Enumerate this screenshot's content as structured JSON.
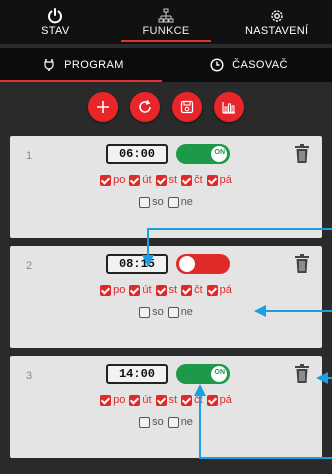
{
  "topnav": {
    "items": [
      {
        "label": "STAV",
        "icon": "power-icon"
      },
      {
        "label": "FUNKCE",
        "icon": "network-icon"
      },
      {
        "label": "NASTAVENÍ",
        "icon": "gear-icon"
      }
    ],
    "active": "FUNKCE"
  },
  "subnav": {
    "items": [
      {
        "label": "PROGRAM",
        "icon": "plug-icon"
      },
      {
        "label": "ČASOVAČ",
        "icon": "clock-icon"
      }
    ],
    "active": "PROGRAM"
  },
  "toolbar": {
    "buttons": [
      "add-icon",
      "refresh-icon",
      "save-icon",
      "chart-icon"
    ]
  },
  "colors": {
    "accent": "#e8262a",
    "toggle_on": "#1c9a4a",
    "toggle_off": "#e02a2a",
    "annotation": "#1aa0e0"
  },
  "programs": [
    {
      "num": "1",
      "time": "06:00",
      "state": "ON",
      "days": [
        {
          "label": "po",
          "checked": true
        },
        {
          "label": "út",
          "checked": true
        },
        {
          "label": "st",
          "checked": true
        },
        {
          "label": "čt",
          "checked": true
        },
        {
          "label": "pá",
          "checked": true
        }
      ],
      "weekend": [
        {
          "label": "so",
          "checked": false
        },
        {
          "label": "ne",
          "checked": false
        }
      ]
    },
    {
      "num": "2",
      "time": "08:15",
      "state": "OFF",
      "days": [
        {
          "label": "po",
          "checked": true
        },
        {
          "label": "út",
          "checked": true
        },
        {
          "label": "st",
          "checked": true
        },
        {
          "label": "čt",
          "checked": true
        },
        {
          "label": "pá",
          "checked": true
        }
      ],
      "weekend": [
        {
          "label": "so",
          "checked": false
        },
        {
          "label": "ne",
          "checked": false
        }
      ]
    },
    {
      "num": "3",
      "time": "14:00",
      "state": "ON",
      "days": [
        {
          "label": "po",
          "checked": true
        },
        {
          "label": "út",
          "checked": true
        },
        {
          "label": "st",
          "checked": true
        },
        {
          "label": "čt",
          "checked": true
        },
        {
          "label": "pá",
          "checked": true
        }
      ],
      "weekend": [
        {
          "label": "so",
          "checked": false
        },
        {
          "label": "ne",
          "checked": false
        }
      ]
    }
  ]
}
